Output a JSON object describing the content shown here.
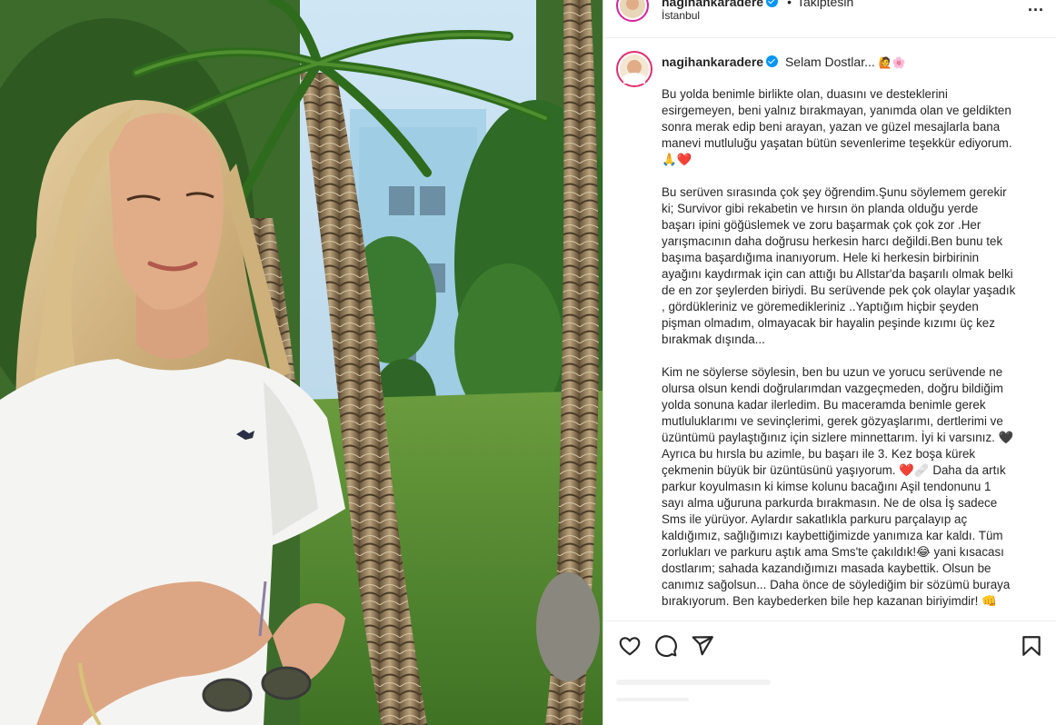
{
  "colors": {
    "accent": "#0095f6",
    "border": "#dbdbdb",
    "text": "#262626",
    "heart": "#ed1c24"
  },
  "header": {
    "username": "nagihankaradere",
    "bullet": "•",
    "follow_status": "Takiptesin",
    "location": "İstanbul",
    "more_icon": "more-horizontal-icon",
    "more_label": "..."
  },
  "post": {
    "username": "nagihankaradere",
    "title": "Selam Dostlar...",
    "paragraph1": [
      "Bu yolda benimle birlikte olan, duasını ve desteklerini",
      "esirgemeyen, beni yalnız bırakmayan, yanımda olan ve geldikten",
      "sonra merak edip beni arayan, yazan ve güzel mesajlarla bana",
      "manevi mutluluğu yaşatan bütün sevenlerime teşekkür ediyorum."
    ],
    "paragraph1_emojis": "🙏❤️",
    "paragraph2": [
      "Bu serüven sırasında çok şey öğrendim.Şunu söylemem gerekir",
      "ki; Survivor gibi rekabetin ve hırsın ön planda olduğu yerde",
      "başarı ipini göğüslemek ve zoru başarmak çok çok zor .Her",
      "yarışmacının daha doğrusu herkesin harcı değildi.Ben bunu tek",
      "başıma başardığıma inanıyorum. Hele ki herkesin birbirinin",
      "ayağını kaydırmak için can attığı bu Allstar'da başarılı olmak belki",
      "de en zor şeylerden biriydi. Bu serüvende pek çok olaylar yaşadık",
      ", gördükleriniz ve göremedikleriniz ..Yaptığım hiçbir şeyden",
      "pişman olmadım, olmayacak bir hayalin peşinde kızımı üç kez",
      "bırakmak dışında..."
    ],
    "paragraph3": [
      "Kim ne söylerse söylesin, ben bu uzun ve yorucu serüvende ne",
      "olursa olsun kendi doğrularımdan vazgeçmeden, doğru bildiğim",
      "yolda sonuna kadar ilerledim. Bu maceramda benimle gerek",
      "mutluluklarımı ve sevinçlerimi, gerek gözyaşlarımı, dertlerimi ve",
      "üzüntümü paylaştığınız için sizlere minnettarım. İyi ki varsınız. 🖤",
      "Ayrıca bu hırsla bu azimle, bu başarı ile 3. Kez boşa kürek",
      "çekmenin büyük bir üzüntüsünü yaşıyorum. ❤️🩹 Daha da artık",
      "parkur koyulmasın ki kimse kolunu bacağını Aşil tendonunu 1",
      "sayı alma uğuruna parkurda bırakmasın. Ne de olsa İş sadece",
      "Sms ile yürüyor. Aylardır sakatlıkla parkuru parçalayıp aç",
      "kaldığımız, sağlığımızı kaybettiğimizde yanımıza kar kaldı. Tüm",
      "zorlukları ve parkuru aştık ama Sms'te çakıldık!😂 yani kısacası",
      "dostlarım; sahada kazandığımızı masada kaybettik. Olsun be",
      "canımız sağolsun... Daha önce de söylediğim bir sözümü buraya",
      "bırakıyorum. Ben kaybederken bile hep kazanan biriyimdir! 👊"
    ]
  },
  "actions": {
    "like_icon": "heart-outline-icon",
    "comment_icon": "comment-bubble-icon",
    "share_icon": "paper-plane-icon",
    "save_icon": "bookmark-icon"
  }
}
